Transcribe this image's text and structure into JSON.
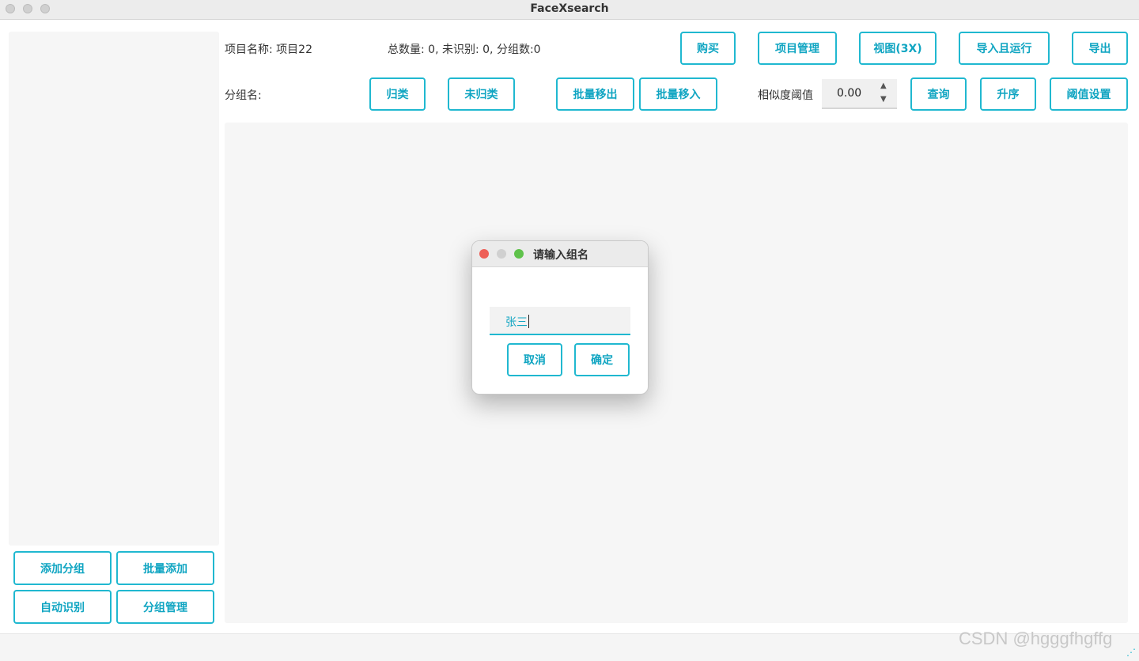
{
  "window": {
    "title": "FaceXsearch"
  },
  "header": {
    "project_label": "项目名称: 项目22",
    "stats": "总数量: 0, 未识别: 0, 分组数:0",
    "group_label": "分组名:",
    "similarity_label": "相似度阈值"
  },
  "toolbar_top": {
    "buy": "购买",
    "project_manage": "项目管理",
    "view": "视图(3X)",
    "import_run": "导入且运行",
    "export": "导出"
  },
  "toolbar_second": {
    "classify": "归类",
    "unclassified": "未归类",
    "batch_out": "批量移出",
    "batch_in": "批量移入",
    "threshold_value": "0.00",
    "query": "查询",
    "ascending": "升序",
    "threshold_settings": "阈值设置"
  },
  "sidebar_buttons": {
    "add_group": "添加分组",
    "batch_add": "批量添加",
    "auto_recognize": "自动识别",
    "group_manage": "分组管理"
  },
  "dialog": {
    "title": "请输入组名",
    "input_value": "张三",
    "cancel": "取消",
    "confirm": "确定"
  },
  "watermark": "CSDN @hgggfhgffg",
  "colors": {
    "accent": "#20b8d0",
    "close": "#ee5f57",
    "zoom": "#5fc24b",
    "disabled": "#d0d0d0"
  }
}
